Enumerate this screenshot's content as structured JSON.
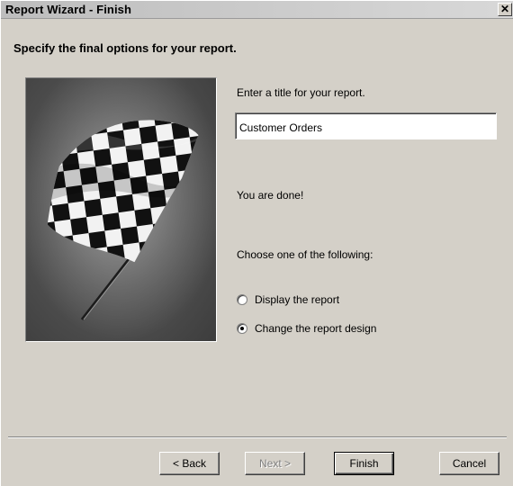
{
  "window": {
    "title": "Report Wizard - Finish",
    "close_glyph": "✕"
  },
  "heading": "Specify the final options for your report.",
  "picture": {
    "icon": "checkered-flag-icon"
  },
  "title_prompt": "Enter a title for your report.",
  "title_input": {
    "value": "Customer Orders"
  },
  "done_text": "You are done!",
  "choose_text": "Choose one of the following:",
  "options": [
    {
      "label": "Display the report",
      "checked": false
    },
    {
      "label": "Change the report design",
      "checked": true
    }
  ],
  "buttons": {
    "back": "< Back",
    "next": "Next >",
    "finish": "Finish",
    "cancel": "Cancel"
  }
}
